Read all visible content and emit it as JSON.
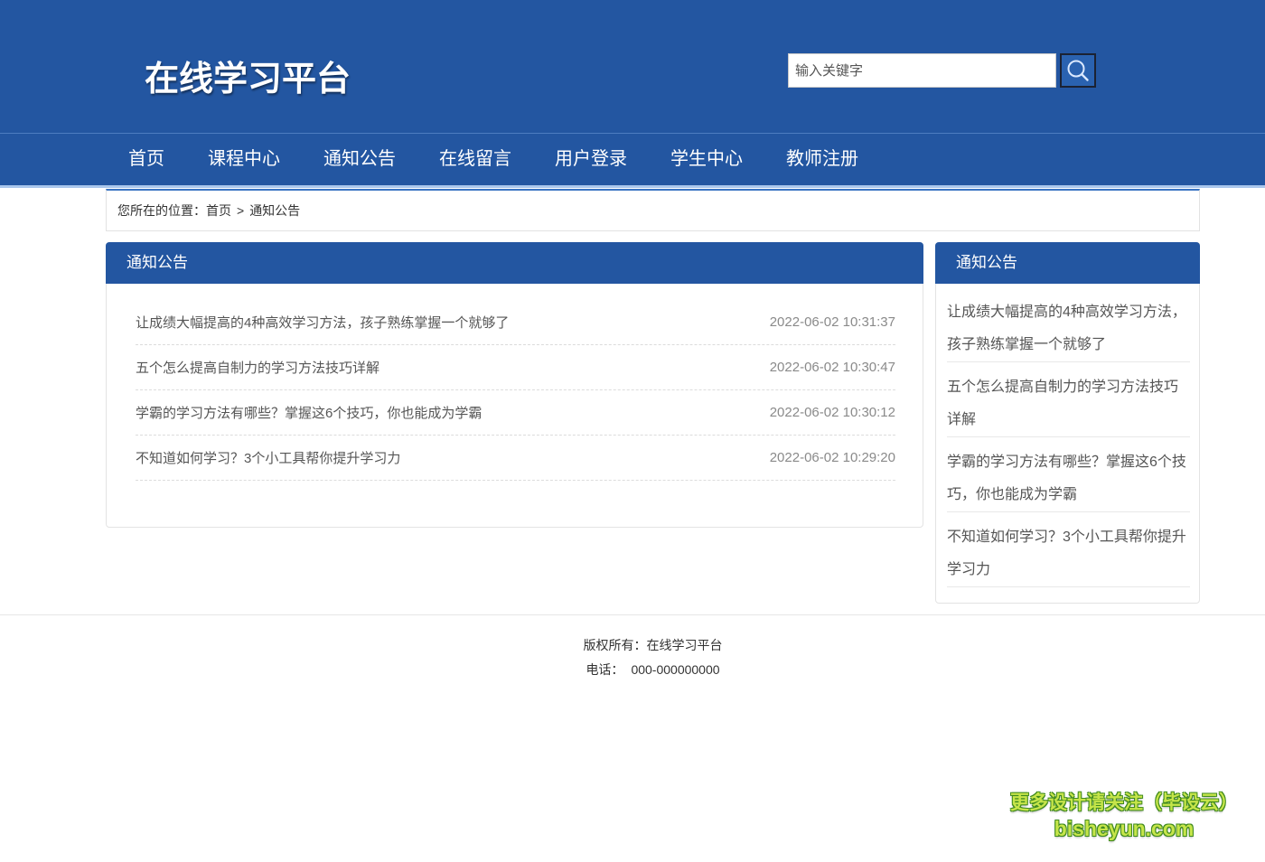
{
  "site": {
    "title": "在线学习平台"
  },
  "search": {
    "placeholder": "输入关键字",
    "button_icon": "search-icon"
  },
  "nav": {
    "items": [
      "首页",
      "课程中心",
      "通知公告",
      "在线留言",
      "用户登录",
      "学生中心",
      "教师注册"
    ]
  },
  "breadcrumb": {
    "prefix": "您所在的位置：",
    "home": "首页",
    "separator": ">",
    "current": "通知公告"
  },
  "main": {
    "title": "通知公告",
    "items": [
      {
        "title": "让成绩大幅提高的4种高效学习方法，孩子熟练掌握一个就够了",
        "date": "2022-06-02 10:31:37"
      },
      {
        "title": "五个怎么提高自制力的学习方法技巧详解",
        "date": "2022-06-02 10:30:47"
      },
      {
        "title": "学霸的学习方法有哪些？掌握这6个技巧，你也能成为学霸",
        "date": "2022-06-02 10:30:12"
      },
      {
        "title": "不知道如何学习？3个小工具帮你提升学习力",
        "date": "2022-06-02 10:29:20"
      }
    ]
  },
  "sidebar": {
    "title": "通知公告",
    "items": [
      "让成绩大幅提高的4种高效学习方法，孩子熟练掌握一个就够了",
      "五个怎么提高自制力的学习方法技巧详解",
      "学霸的学习方法有哪些？掌握这6个技巧，你也能成为学霸",
      "不知道如何学习？3个小工具帮你提升学习力"
    ]
  },
  "footer": {
    "copyright": "版权所有：在线学习平台",
    "phone_label": "电话：",
    "phone": "000-000000000"
  },
  "watermark": {
    "line1": "更多设计请关注（毕设云）",
    "line2": "bisheyun.com"
  },
  "colors": {
    "primary": "#2356a1",
    "nav_underline": "#a9c6ec",
    "list_text": "#555555",
    "date_text": "#8a8a8a",
    "watermark_fill": "#c6e54a",
    "watermark_outline": "#3f8a1e"
  }
}
